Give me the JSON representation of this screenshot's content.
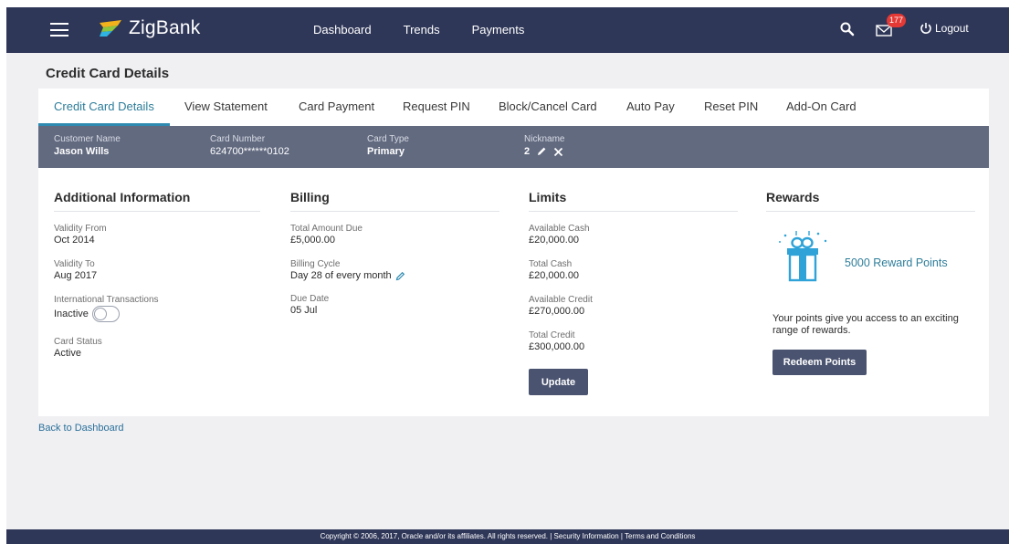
{
  "header": {
    "brand": "ZigBank",
    "nav": [
      "Dashboard",
      "Trends",
      "Payments"
    ],
    "mail_count": "177",
    "logout_label": "Logout"
  },
  "page": {
    "title": "Credit Card Details"
  },
  "tabs": [
    "Credit Card Details",
    "View Statement",
    "Card Payment",
    "Request PIN",
    "Block/Cancel Card",
    "Auto Pay",
    "Reset PIN",
    "Add-On Card"
  ],
  "active_tab": "Credit Card Details",
  "summary": {
    "customer_name_label": "Customer Name",
    "customer_name": "Jason Wills",
    "card_number_label": "Card Number",
    "card_number": "624700******0102",
    "card_type_label": "Card Type",
    "card_type": "Primary",
    "nickname_label": "Nickname",
    "nickname": "2"
  },
  "additional": {
    "heading": "Additional Information",
    "validity_from_label": "Validity From",
    "validity_from": "Oct 2014",
    "validity_to_label": "Validity To",
    "validity_to": "Aug 2017",
    "intl_label": "International Transactions",
    "intl_status": "Inactive",
    "card_status_label": "Card Status",
    "card_status": "Active"
  },
  "billing": {
    "heading": "Billing",
    "total_due_label": "Total Amount Due",
    "total_due": "£5,000.00",
    "cycle_label": "Billing Cycle",
    "cycle": "Day 28 of every month",
    "due_date_label": "Due Date",
    "due_date": "05 Jul"
  },
  "limits": {
    "heading": "Limits",
    "available_cash_label": "Available Cash",
    "available_cash": "£20,000.00",
    "total_cash_label": "Total Cash",
    "total_cash": "£20,000.00",
    "available_credit_label": "Available Credit",
    "available_credit": "£270,000.00",
    "total_credit_label": "Total Credit",
    "total_credit": "£300,000.00",
    "update_label": "Update"
  },
  "rewards": {
    "heading": "Rewards",
    "points": "5000  Reward Points",
    "description": "Your points give you access to an exciting range of rewards.",
    "redeem_label": "Redeem Points"
  },
  "back_link": "Back to Dashboard",
  "footer": "Copyright © 2006, 2017, Oracle and/or its affiliates. All rights reserved. | Security Information | Terms and Conditions",
  "colors": {
    "header_bg": "#2f3758",
    "info_bar_bg": "#626a80",
    "accent": "#2e8ab0",
    "button_bg": "#4a5370",
    "badge": "#e53935"
  },
  "icons": [
    "menu-icon",
    "zigbank-logo-icon",
    "search-icon",
    "mail-icon",
    "power-icon",
    "pencil-icon",
    "close-icon",
    "gift-icon"
  ]
}
